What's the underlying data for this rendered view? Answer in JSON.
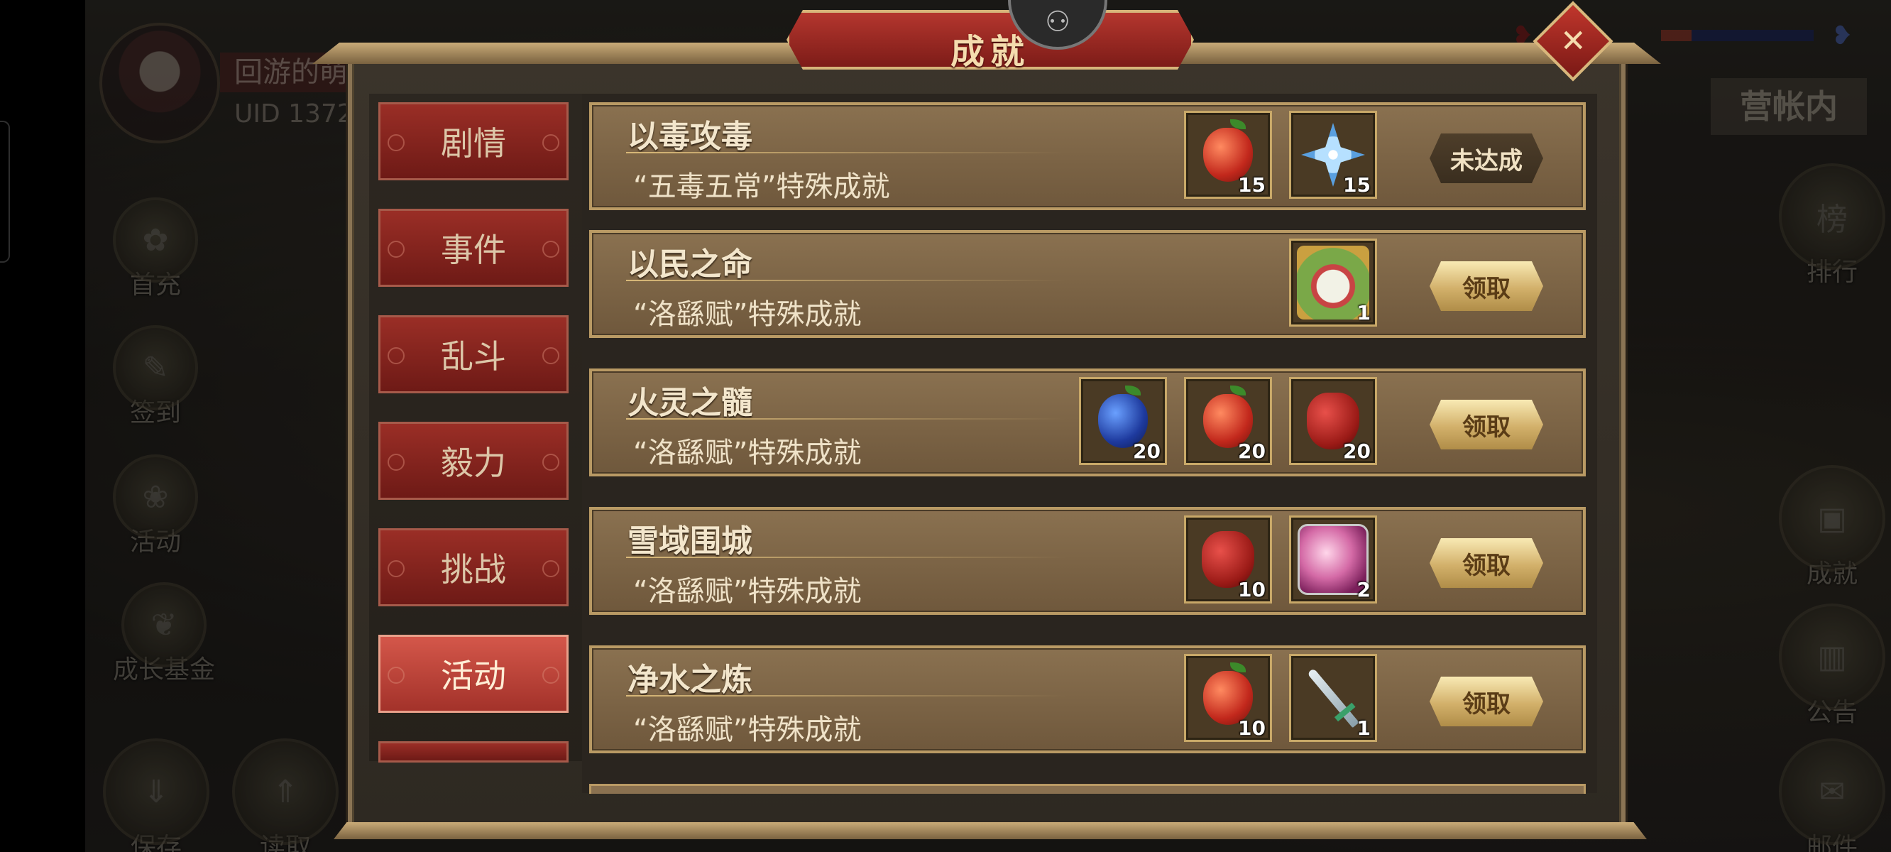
{
  "background": {
    "player_name": "回游的萌",
    "player_uid": "UID 1372",
    "camp_label": "营帐内",
    "left_buttons": [
      {
        "label": "首充",
        "icon": "gift-bag-icon"
      },
      {
        "label": "签到",
        "icon": "sign-in-icon"
      },
      {
        "label": "活动",
        "icon": "activity-icon"
      },
      {
        "label": "成长基金",
        "icon": "growth-fund-icon"
      }
    ],
    "bottom_left_buttons": [
      {
        "label": "保存",
        "icon": "save-scroll-icon"
      },
      {
        "label": "读取",
        "icon": "load-scroll-icon"
      }
    ],
    "right_buttons": [
      {
        "label": "排行",
        "icon": "ranking-icon",
        "glyph": "榜"
      },
      {
        "label": "成就",
        "icon": "achievement-chest-icon"
      },
      {
        "label": "公告",
        "icon": "announcement-icon"
      },
      {
        "label": "邮件",
        "icon": "mail-icon"
      }
    ]
  },
  "dialog": {
    "title": "成就",
    "close_glyph": "✕",
    "emblem_glyph": "⚇"
  },
  "tabs": [
    {
      "label": "剧情",
      "active": false
    },
    {
      "label": "事件",
      "active": false
    },
    {
      "label": "乱斗",
      "active": false
    },
    {
      "label": "毅力",
      "active": false
    },
    {
      "label": "挑战",
      "active": false
    },
    {
      "label": "活动",
      "active": true
    }
  ],
  "achievements": [
    {
      "name": "以毒攻毒",
      "desc": "“五毒五常”特殊成就",
      "rewards": [
        {
          "icon": "red-pear-icon",
          "qty": "15"
        },
        {
          "icon": "ice-crystal-icon",
          "qty": "15"
        }
      ],
      "button": "未达成",
      "state": "pending"
    },
    {
      "name": "以民之命",
      "desc": "“洛繇赋”特殊成就",
      "rewards": [
        {
          "icon": "mascot-card-icon",
          "qty": "1"
        }
      ],
      "button": "领取",
      "state": "claim"
    },
    {
      "name": "火灵之髓",
      "desc": "“洛繇赋”特殊成就",
      "rewards": [
        {
          "icon": "blue-pear-icon",
          "qty": "20"
        },
        {
          "icon": "red-pear-icon",
          "qty": "20"
        },
        {
          "icon": "red-glove-icon",
          "qty": "20"
        }
      ],
      "button": "领取",
      "state": "claim"
    },
    {
      "name": "雪域围城",
      "desc": "“洛繇赋”特殊成就",
      "rewards": [
        {
          "icon": "red-glove-icon",
          "qty": "10"
        },
        {
          "icon": "pink-gem-icon",
          "qty": "2"
        }
      ],
      "button": "领取",
      "state": "claim"
    },
    {
      "name": "净水之炼",
      "desc": "“洛繇赋”特殊成就",
      "rewards": [
        {
          "icon": "red-pear-icon",
          "qty": "10"
        },
        {
          "icon": "jade-sword-icon",
          "qty": "1"
        }
      ],
      "button": "领取",
      "state": "claim"
    }
  ]
}
